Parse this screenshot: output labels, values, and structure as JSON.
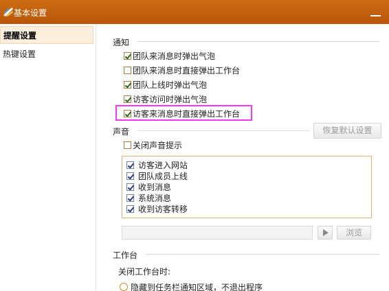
{
  "window": {
    "title": "基本设置"
  },
  "sidebar": {
    "items": [
      {
        "label": "提醒设置",
        "active": true
      },
      {
        "label": "热键设置",
        "active": false
      }
    ]
  },
  "notify": {
    "section_label": "通知",
    "options": [
      {
        "label": "团队来消息时弹出气泡",
        "checked": true
      },
      {
        "label": "团队来消息时直接弹出工作台",
        "checked": false
      },
      {
        "label": "团队上线时弹出气泡",
        "checked": true
      },
      {
        "label": "访客访问时弹出气泡",
        "checked": true
      },
      {
        "label": "访客来消息时直接弹出工作台",
        "checked": true
      }
    ]
  },
  "sound": {
    "section_label": "声音",
    "restore_label": "恢复默认设置",
    "mute": {
      "label": "关闭声音提示",
      "checked": false
    },
    "events": [
      {
        "label": "访客进入网站",
        "checked": true
      },
      {
        "label": "团队成员上线",
        "checked": true
      },
      {
        "label": "收到消息",
        "checked": true
      },
      {
        "label": "系统消息",
        "checked": true
      },
      {
        "label": "收到访客转移",
        "checked": true
      }
    ],
    "file_path": "",
    "browse_label": "浏览"
  },
  "workbench": {
    "section_label": "工作台",
    "close_label": "关闭工作台时:",
    "close_options": [
      {
        "label": "隐藏到任务栏通知区域，不退出程序",
        "selected": false
      }
    ]
  },
  "colors": {
    "titlebar": "#c2620a",
    "highlight": "#ff33ff",
    "list_border": "#e6b070"
  }
}
